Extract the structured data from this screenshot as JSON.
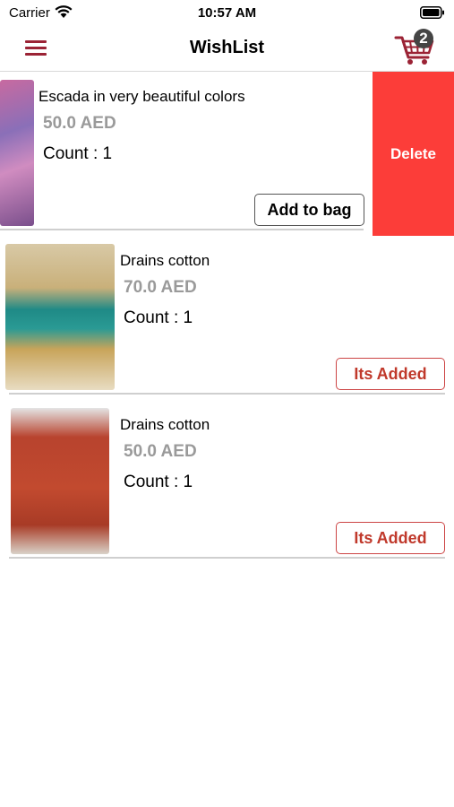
{
  "status_bar": {
    "carrier": "Carrier",
    "time": "10:57 AM"
  },
  "nav": {
    "title": "WishList",
    "cart_count": "2"
  },
  "items": [
    {
      "name": "Escada in very beautiful colors",
      "price": "50.0 AED",
      "count": "Count :  1",
      "button": "Add to bag",
      "swipe_action": "Delete"
    },
    {
      "name": "Drains cotton",
      "price": "70.0 AED",
      "count": "Count :  1",
      "button": "Its Added"
    },
    {
      "name": "Drains cotton",
      "price": "50.0 AED",
      "count": "Count :  1",
      "button": "Its Added"
    }
  ],
  "colors": {
    "accent": "#9b2335",
    "delete": "#fc3d39",
    "price": "#9a9a9a",
    "added_text": "#c0392b"
  },
  "icons": [
    "menu-icon",
    "cart-icon",
    "wifi-icon",
    "battery-icon"
  ]
}
